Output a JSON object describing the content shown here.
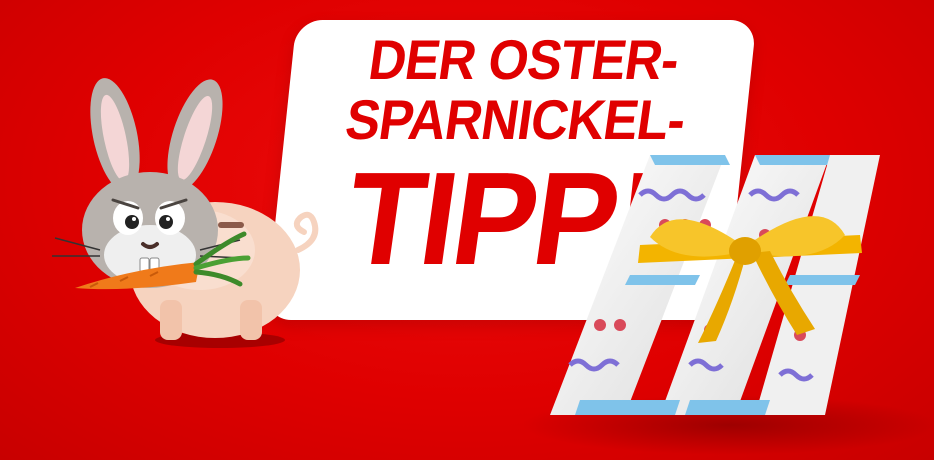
{
  "headline": {
    "line1": "DER OSTER-",
    "line2": "SPARNICKEL-",
    "line3": "TIPP!"
  },
  "colors": {
    "background": "#df0000",
    "headline_text": "#e00000",
    "bubble": "#ffffff",
    "bow": "#f3b400",
    "egg_blue": "#7fc3ea",
    "egg_purple": "#7e6fd6",
    "egg_red": "#d94a5a"
  },
  "illustrations": {
    "rabbit": "easter-bunny-icon",
    "piggy_bank": "piggy-bank-icon",
    "carrot": "carrot-icon",
    "logo": "mediamarkt-m-easter-egg-logo"
  }
}
